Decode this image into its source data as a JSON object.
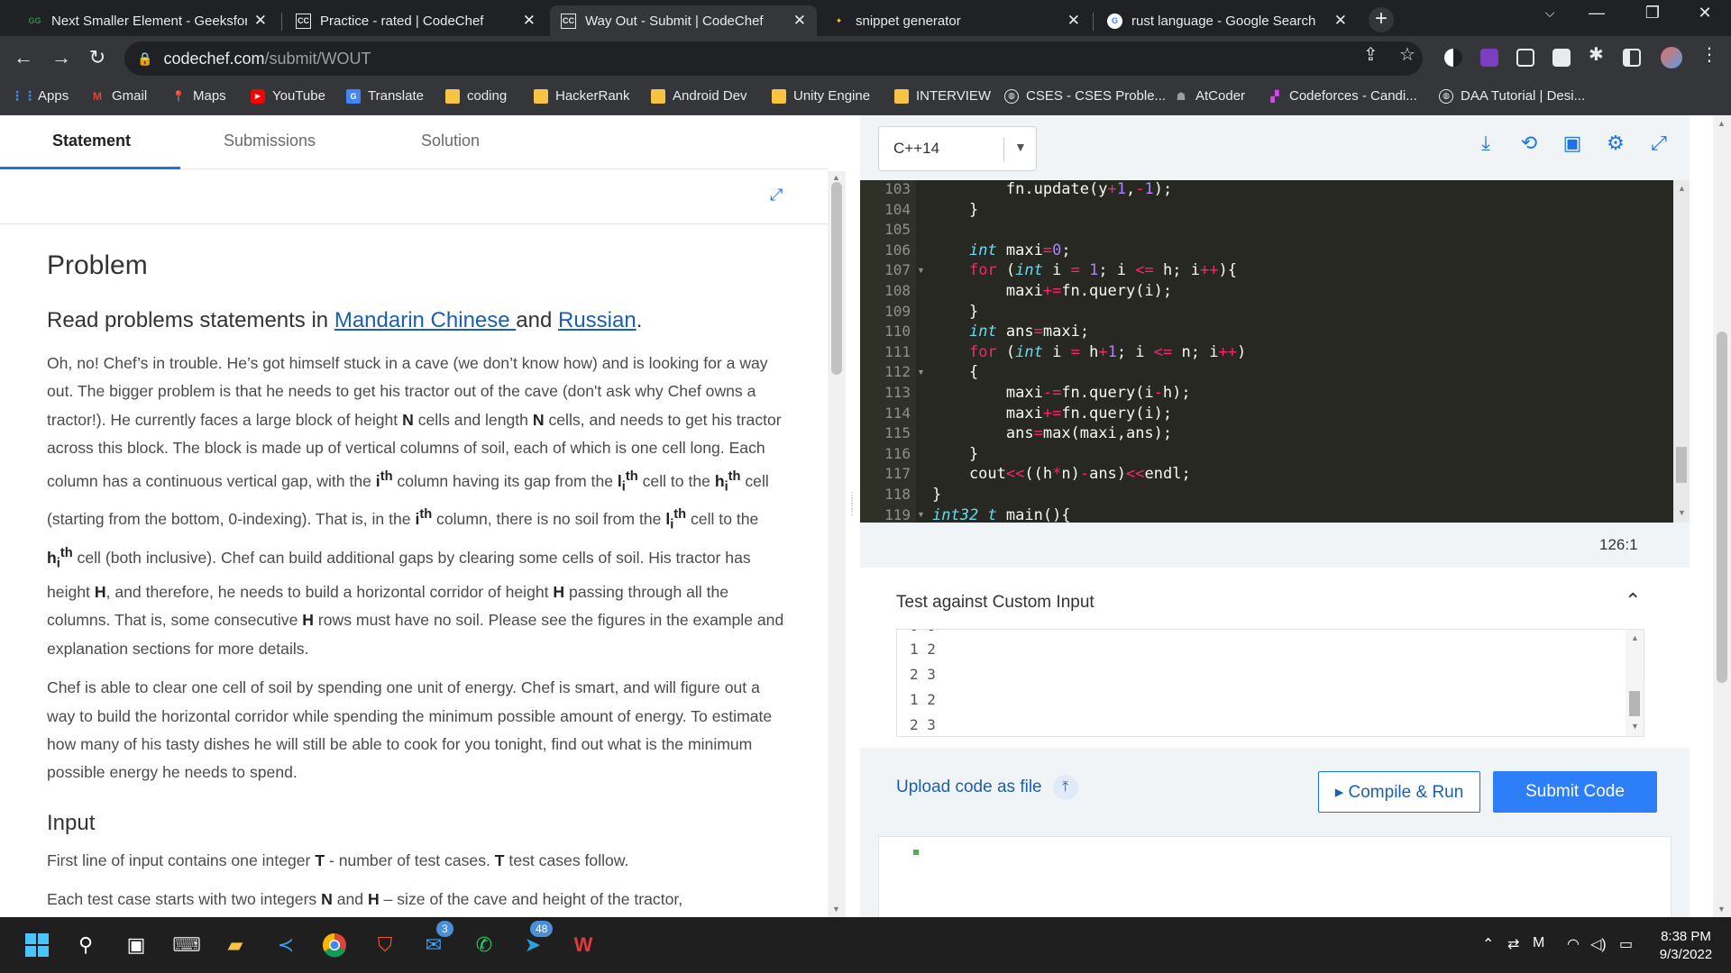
{
  "browser": {
    "tabs": [
      {
        "title": "Next Smaller Element - Geeksfor",
        "icon": "geeksforgeeks-icon"
      },
      {
        "title": "Practice - rated | CodeChef",
        "icon": "codechef-icon"
      },
      {
        "title": "Way Out - Submit | CodeChef",
        "icon": "codechef-icon"
      },
      {
        "title": "snippet generator",
        "icon": "snippet-icon"
      },
      {
        "title": "rust language - Google Search",
        "icon": "google-icon"
      }
    ],
    "url_host": "codechef.com",
    "url_path": "/submit/WOUT"
  },
  "bookmarks": [
    {
      "label": "Apps",
      "icon": "apps-grid-icon"
    },
    {
      "label": "Gmail",
      "icon": "gmail-icon"
    },
    {
      "label": "Maps",
      "icon": "maps-icon"
    },
    {
      "label": "YouTube",
      "icon": "youtube-icon"
    },
    {
      "label": "Translate",
      "icon": "translate-icon"
    },
    {
      "label": "coding",
      "icon": "folder-icon"
    },
    {
      "label": "HackerRank",
      "icon": "folder-icon"
    },
    {
      "label": "Android Dev",
      "icon": "folder-icon"
    },
    {
      "label": "Unity Engine",
      "icon": "folder-icon"
    },
    {
      "label": "INTERVIEW",
      "icon": "folder-icon"
    },
    {
      "label": "CSES - CSES Proble...",
      "icon": "globe-icon"
    },
    {
      "label": "AtCoder",
      "icon": "atcoder-icon"
    },
    {
      "label": "Codeforces - Candi...",
      "icon": "codeforces-icon"
    },
    {
      "label": "DAA Tutorial | Desi...",
      "icon": "globe-icon"
    }
  ],
  "problem_tabs": [
    "Statement",
    "Submissions",
    "Solution"
  ],
  "problem": {
    "heading": "Problem",
    "read_prefix": "Read problems statements in ",
    "lang1": "Mandarin Chinese ",
    "read_and": "and ",
    "lang2": "Russian",
    "read_suffix": ".",
    "p1": [
      "Oh, no! Chef’s in trouble. He’s got himself stuck in a cave (we don’t know how) and is looking for a way out. The bigger problem is that he needs to get his tractor out of the cave (don't ask why Chef owns a tractor!). He currently faces a large block of height ",
      "N",
      " cells and length ",
      "N",
      " cells, and needs to get his tractor across this block. The block is made up of vertical columns of soil, each of which is one cell long. Each column has a continuous vertical gap, with the ",
      "i",
      "th",
      " column having its gap from the ",
      "l",
      "i",
      "th",
      " cell to the ",
      "h",
      "i",
      "th",
      " cell (starting from the bottom, 0-indexing). That is, in the ",
      "i",
      "th",
      " column, there is no soil from the ",
      "l",
      "i",
      "th",
      " cell to the ",
      "h",
      "i",
      "th",
      " cell (both inclusive). Chef can build additional gaps by clearing some cells of soil. His tractor has height ",
      "H",
      ", and therefore, he needs to build a horizontal corridor of height ",
      "H",
      " passing through all the columns. That is, some consecutive ",
      "H",
      " rows must have no soil. Please see the figures in the example and explanation sections for more details."
    ],
    "p2": "Chef is able to clear one cell of soil by spending one unit of energy. Chef is smart, and will figure out a way to build the horizontal corridor while spending the minimum possible amount of energy. To estimate how many of his tasty dishes he will still be able to cook for you tonight, find out what is the minimum possible energy he needs to spend.",
    "input_heading": "Input",
    "input_p1": [
      "First line of input contains one integer ",
      "T",
      " - number of test cases. ",
      "T",
      " test cases follow."
    ],
    "input_p2": [
      "Each test case starts with two integers ",
      "N",
      " and ",
      "H",
      " – size of the cave and height of the tractor,"
    ]
  },
  "editor": {
    "language": "C++14",
    "cursor": "126:1",
    "line_numbers": [
      "103",
      "104",
      "105",
      "106",
      "107",
      "108",
      "109",
      "110",
      "111",
      "112",
      "113",
      "114",
      "115",
      "116",
      "117",
      "118",
      "119"
    ],
    "lines": [
      "        fn.update(y+1,-1);",
      "    }",
      "",
      "    int maxi=0;",
      "    for (int i = 1; i <= h; i++){",
      "        maxi+=fn.query(i);",
      "    }",
      "    int ans=maxi;",
      "    for (int i = h+1; i <= n; i++)",
      "    {",
      "        maxi-=fn.query(i-h);",
      "        maxi+=fn.query(i);",
      "        ans=max(maxi,ans);",
      "    }",
      "    cout<<((h*n)-ans)<<endl;",
      "}",
      "int32_t main(){"
    ]
  },
  "custom_input": {
    "title": "Test against Custom Input",
    "lines": [
      "1 2",
      "2 3",
      "1 2",
      "2 3"
    ]
  },
  "actions": {
    "upload": "Upload code as file",
    "compile": "Compile & Run",
    "submit": "Submit Code"
  },
  "taskbar": {
    "mail_badge": "3",
    "telegram_badge": "48",
    "time": "8:38 PM",
    "date": "9/3/2022"
  }
}
